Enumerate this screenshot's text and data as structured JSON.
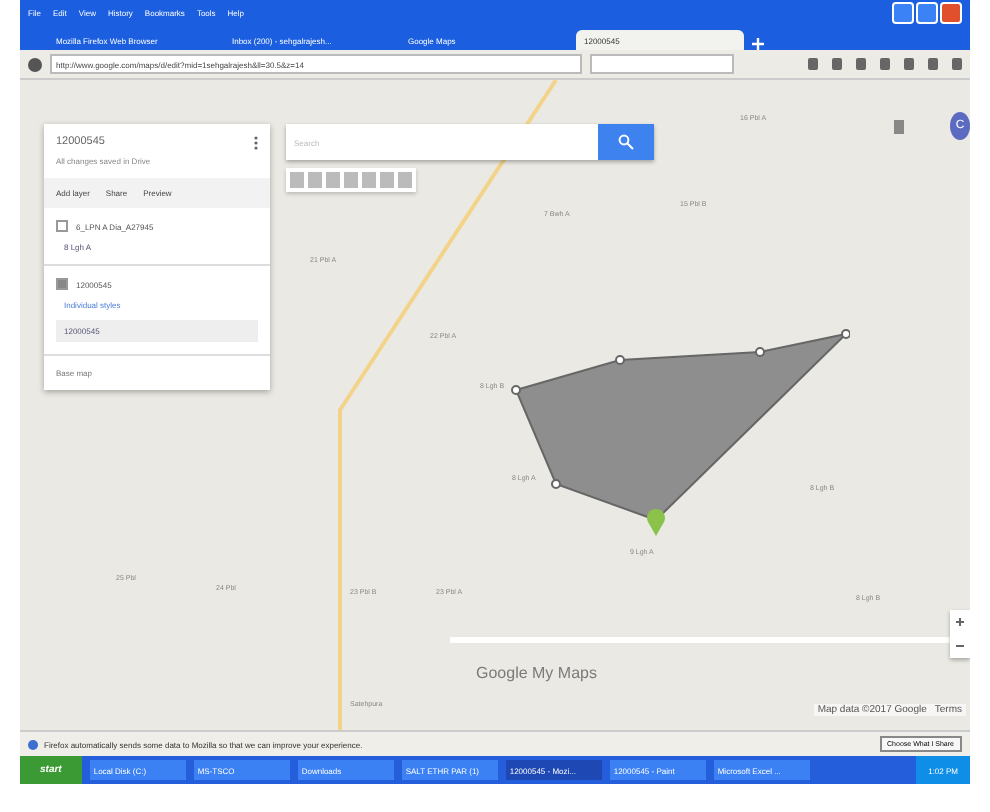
{
  "menu_bar": [
    "File",
    "Edit",
    "View",
    "History",
    "Bookmarks",
    "Tools",
    "Help"
  ],
  "tabs": [
    {
      "label": "Mozilla Firefox Web Browser",
      "selected": false
    },
    {
      "label": "Inbox (200) - sehgalrajesh...",
      "selected": false
    },
    {
      "label": "Google Maps",
      "selected": false
    },
    {
      "label": "12000545",
      "selected": true
    }
  ],
  "address_bar": {
    "value": "http://www.google.com/maps/d/edit?mid=1sehgalrajesh&ll=30.5&z=14"
  },
  "search_field": {
    "placeholder": "Search"
  },
  "map_panel": {
    "title": "12000545",
    "subtitle": "All changes saved in Drive",
    "actions": [
      "Add layer",
      "Share",
      "Preview"
    ],
    "layers": [
      {
        "title": "6_LPN A Dia_A27945",
        "expanded": false,
        "items": [
          {
            "label": "8 Lgh A"
          }
        ]
      },
      {
        "title": "12000545",
        "expanded": true,
        "items": [
          {
            "label": "Individual styles"
          },
          {
            "label": "12000545"
          }
        ]
      }
    ],
    "base_map": "Base map"
  },
  "account": {
    "initial": "C"
  },
  "map_labels": [
    "16 Pbl A",
    "7 Bwh A",
    "15 Pbl B",
    "21 Pbl A",
    "22 Pbl A",
    "8 Lgh B",
    "8 Lgh A",
    "9 Lgh A",
    "8 Lgh B",
    "25 Pbl",
    "24 Pbl",
    "23 Pbl B",
    "23 Pbl A",
    "8 Lgh B",
    "Satehpura"
  ],
  "logo": "Google My Maps",
  "attribution": [
    "Map data ©2017 Google",
    "Terms"
  ],
  "notification": {
    "text": "Firefox automatically sends some data to Mozilla so that we can improve your experience.",
    "button": "Choose What I Share"
  },
  "taskbar": {
    "start": "start",
    "items": [
      {
        "label": "Local Disk (C:)",
        "selected": false
      },
      {
        "label": "MS-TSCO",
        "selected": false
      },
      {
        "label": "Downloads",
        "selected": false
      },
      {
        "label": "SALT ETHR PAR (1)",
        "selected": false
      },
      {
        "label": "12000545 - Mozi...",
        "selected": true
      },
      {
        "label": "12000545 - Paint",
        "selected": false
      },
      {
        "label": "Microsoft Excel ...",
        "selected": false
      }
    ],
    "clock": "1:02 PM"
  }
}
